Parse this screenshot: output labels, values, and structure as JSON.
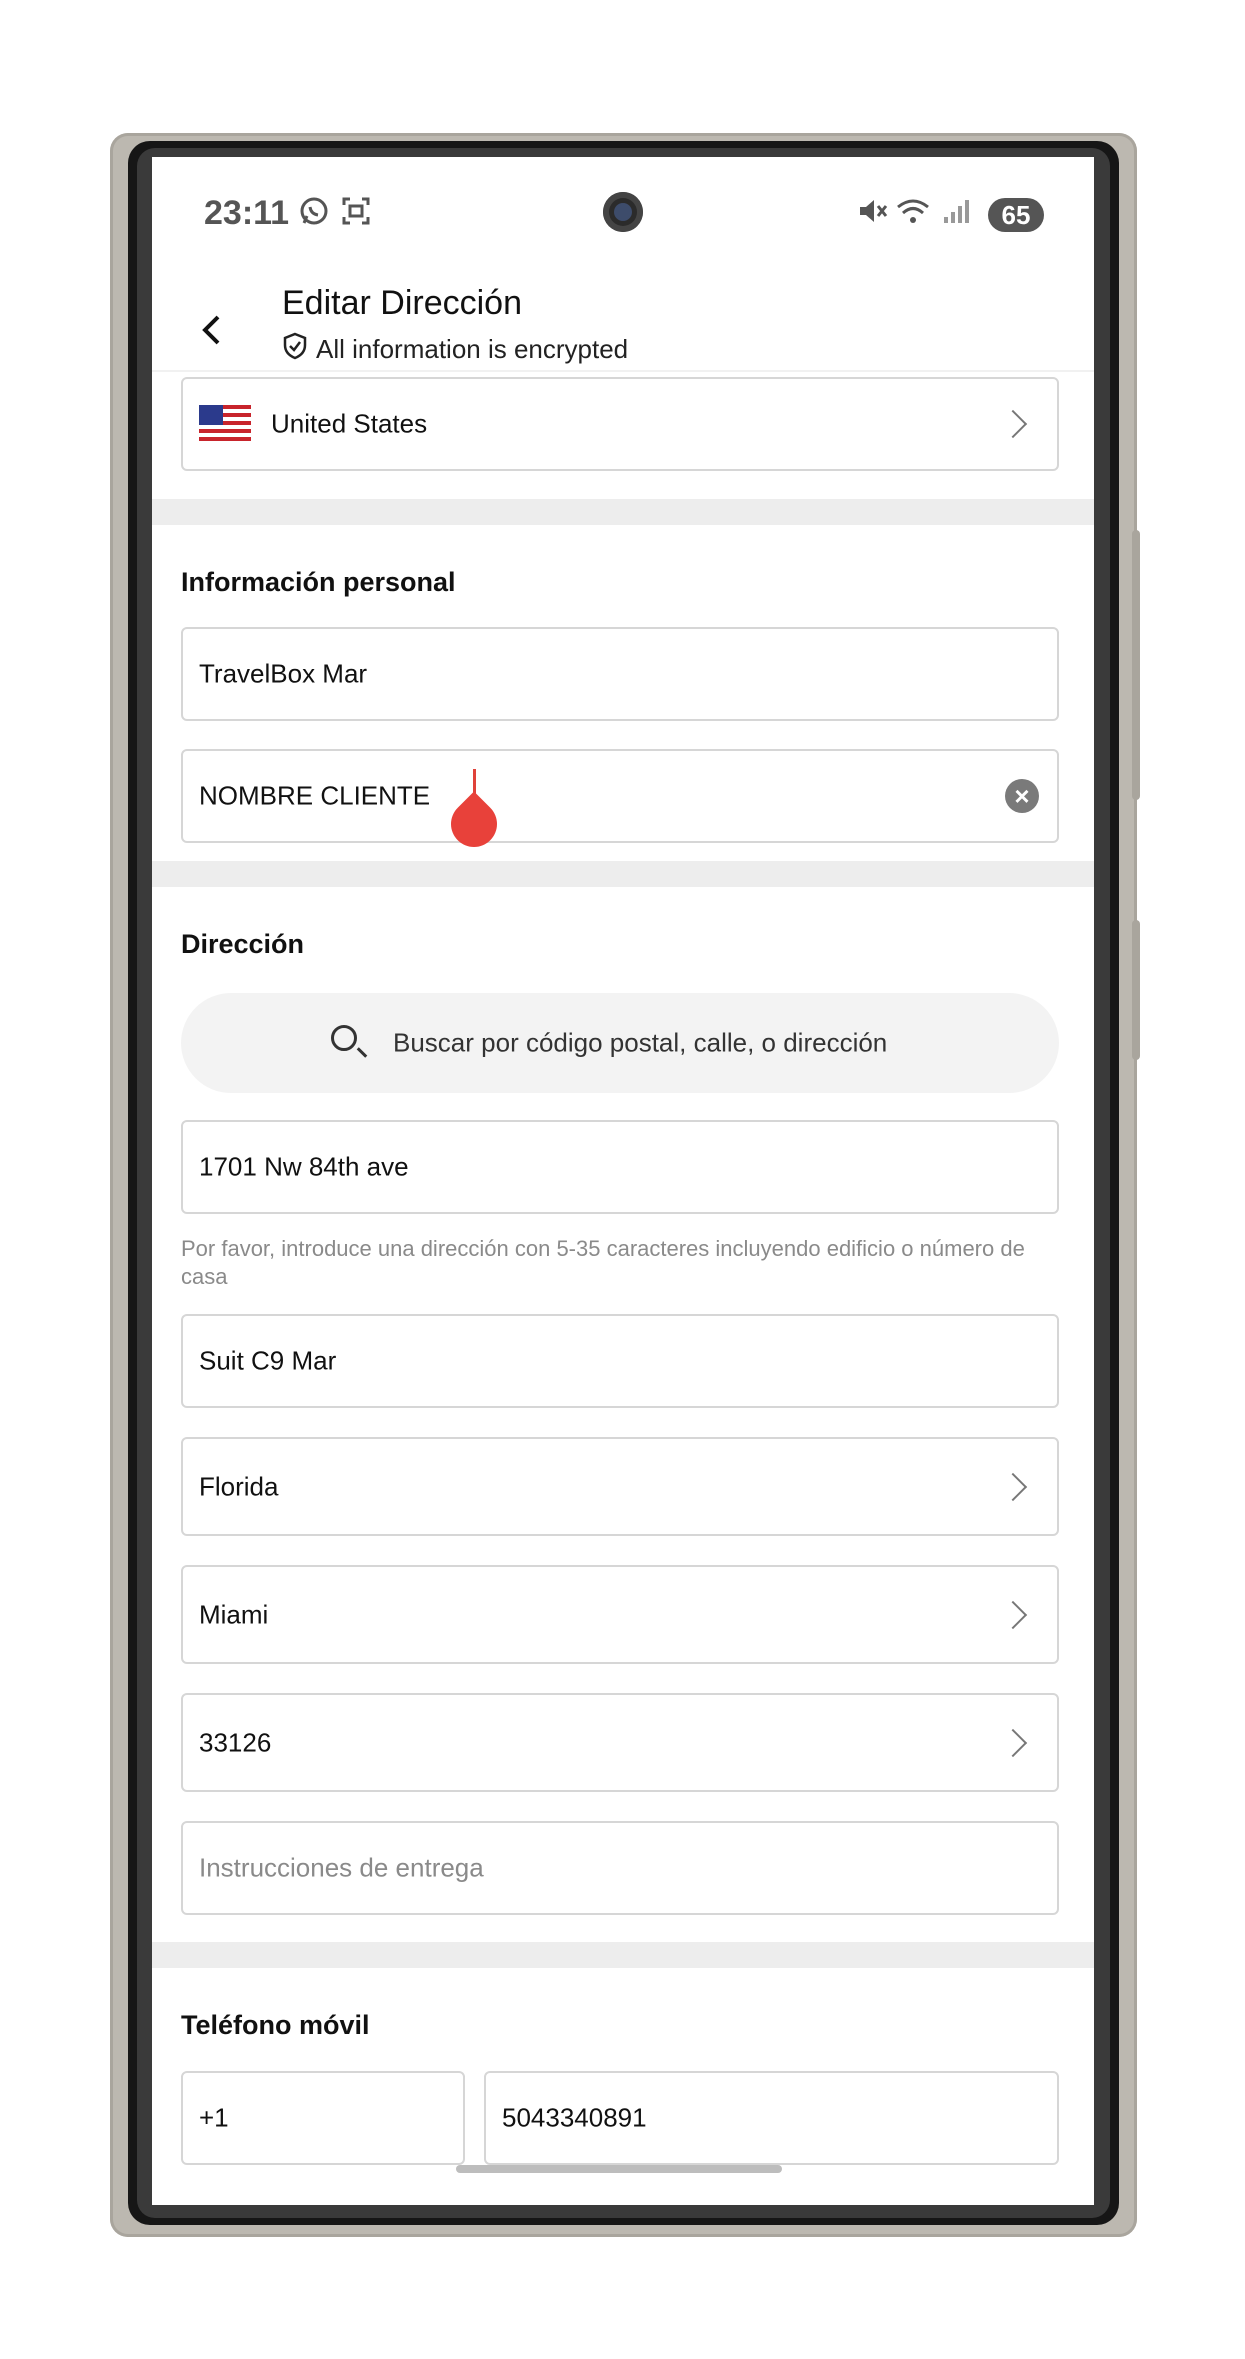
{
  "status_bar": {
    "time": "23:11",
    "left_icons": [
      "whatsapp-icon",
      "screenshot-icon"
    ],
    "right_icons": [
      "mute-icon",
      "wifi-icon",
      "signal-icon"
    ],
    "battery": "65"
  },
  "header": {
    "title": "Editar Dirección",
    "subtitle": "All information is encrypted",
    "back_icon": "chevron-left-icon",
    "shield_icon": "shield-check-icon"
  },
  "country": {
    "label": "United States",
    "flag": "us-flag-icon"
  },
  "personal": {
    "section_title": "Información personal",
    "first_name": "TravelBox Mar",
    "last_name": "NOMBRE CLIENTE"
  },
  "address": {
    "section_title": "Dirección",
    "search_placeholder": "Buscar por código postal, calle, o dirección",
    "line1": "1701 Nw 84th ave",
    "line1_hint": "Por favor, introduce una dirección con 5-35 caracteres incluyendo edificio o número de casa",
    "line2": "Suit C9 Mar",
    "state": "Florida",
    "city": "Miami",
    "zip": "33126",
    "instructions_placeholder": "Instrucciones de entrega"
  },
  "phone": {
    "section_title": "Teléfono móvil",
    "country_code": "+1",
    "number": "5043340891"
  },
  "colors": {
    "accent_cursor": "#e8413a",
    "divider_bar": "#ededed",
    "border": "#d6d6d6"
  }
}
